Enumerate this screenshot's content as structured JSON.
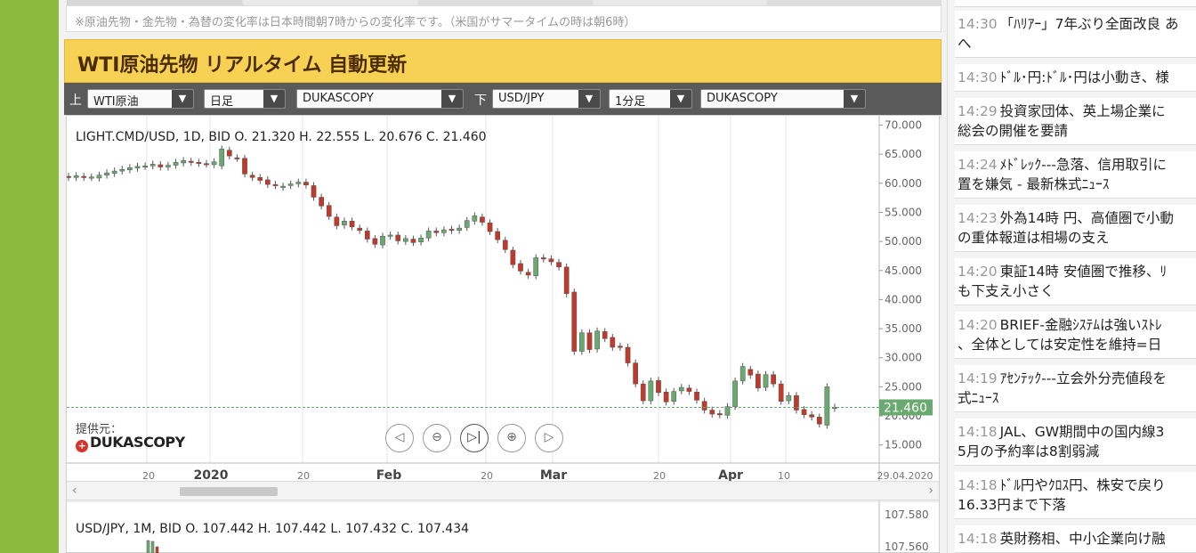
{
  "top_note": "※原油先物・金先物・為替の変化率は日本時間朝7時からの変化率です。（米国がサマータイムの時は朝6時）",
  "section_title": "WTI原油先物 リアルタイム 自動更新",
  "controls": {
    "upper_label": "上",
    "lower_label": "下",
    "upper_symbol": "WTI原油",
    "upper_period": "日足",
    "upper_source": "DUKASCOPY",
    "lower_symbol": "USD/JPY",
    "lower_period": "1分足",
    "lower_source": "DUKASCOPY",
    "dropdown_arrow": "▼"
  },
  "chart_upper": {
    "ohlc_text": "LIGHT.CMD/USD, 1D, BID   O. 21.320 H. 22.555 L. 20.676 C. 21.460",
    "price_ticks": [
      "70.000",
      "65.000",
      "60.000",
      "55.000",
      "50.000",
      "45.000",
      "40.000",
      "35.000",
      "30.000",
      "25.000",
      "20.000",
      "15.000"
    ],
    "current_price": "21.460",
    "x_ticks": [
      "20",
      "2020",
      "20",
      "Feb",
      "20",
      "Mar",
      "20",
      "Apr",
      "10",
      "29.04.2020"
    ],
    "provider_label": "提供元：",
    "provider_logo": "DUKASCOPY"
  },
  "chart_lower": {
    "ohlc_text": "USD/JPY, 1M, BID   O. 107.442 H. 107.442 L. 107.432 C. 107.434",
    "price_ticks": [
      "107.580",
      "107.560"
    ]
  },
  "nav_buttons": [
    {
      "name": "scroll-left-button",
      "glyph": "◁"
    },
    {
      "name": "zoom-out-button",
      "glyph": "⊖"
    },
    {
      "name": "reset-button",
      "glyph": "▷|"
    },
    {
      "name": "zoom-in-button",
      "glyph": "⊕"
    },
    {
      "name": "scroll-right-button",
      "glyph": "▷"
    }
  ],
  "scroll_arrows": {
    "left": "‹",
    "right": "›"
  },
  "colors": {
    "up": "#6aa96f",
    "down": "#c0392b",
    "title_bg": "#f7d154",
    "price_marker": "#6aa96f"
  },
  "news": [
    {
      "time": "14:30",
      "text": "「ﾊﾘｱｰ」7年ぶり全面改良 あ",
      "line2": "へ"
    },
    {
      "time": "14:30",
      "text": "ﾄﾞﾙ･円:ﾄﾞﾙ･円は小動き、様",
      "line2": ""
    },
    {
      "time": "14:29",
      "text": "投資家団体、英上場企業に",
      "line2": "総会の開催を要請"
    },
    {
      "time": "14:24",
      "text": "ﾒﾄﾞﾚｯｸ---急落、信用取引に",
      "line2": "置を嫌気 - 最新株式ﾆｭｰｽ"
    },
    {
      "time": "14:23",
      "text": "外為14時 円、高値圏で小動",
      "line2": "の重体報道は相場の支え"
    },
    {
      "time": "14:20",
      "text": "東証14時 安値圏で推移、ﾘ",
      "line2": "も下支え小さく"
    },
    {
      "time": "14:20",
      "text": "BRIEF-金融ｼｽﾃﾑは強いｽﾄﾚ",
      "line2": "、全体としては安定性を維持=日"
    },
    {
      "time": "14:19",
      "text": "ｱｾﾝﾃｯｸ---立会外分売値段を",
      "line2": "式ﾆｭｰｽ"
    },
    {
      "time": "14:18",
      "text": "JAL、GW期間中の国内線3",
      "line2": "5月の予約率は8割弱減"
    },
    {
      "time": "14:18",
      "text": "ﾄﾞﾙ円やｸﾛｽ円、株安で戻り",
      "line2": "16.33円まで下落"
    },
    {
      "time": "14:18",
      "text": "英財務相、中小企業向け融",
      "line2": ""
    }
  ],
  "chart_data": {
    "type": "candlestick",
    "title": "LIGHT.CMD/USD, 1D, BID",
    "ylim": [
      12.5,
      71
    ],
    "candles": [
      [
        61.2,
        61.0
      ],
      [
        61.0,
        61.3
      ],
      [
        61.2,
        61.0
      ],
      [
        61.0,
        61.1
      ],
      [
        60.9,
        61.4
      ],
      [
        61.4,
        61.8
      ],
      [
        61.7,
        62.1
      ],
      [
        62.1,
        62.4
      ],
      [
        62.3,
        62.7
      ],
      [
        62.6,
        62.9
      ],
      [
        62.9,
        63.0
      ],
      [
        63.0,
        63.3
      ],
      [
        63.2,
        62.8
      ],
      [
        62.8,
        63.1
      ],
      [
        63.1,
        63.6
      ],
      [
        63.5,
        63.9
      ],
      [
        63.8,
        63.6
      ],
      [
        63.6,
        63.4
      ],
      [
        63.4,
        63.3
      ],
      [
        63.2,
        63.7
      ],
      [
        63.0,
        65.9
      ],
      [
        65.7,
        64.7
      ],
      [
        64.4,
        64.3
      ],
      [
        64.3,
        61.6
      ],
      [
        61.4,
        61.0
      ],
      [
        61.0,
        60.5
      ],
      [
        60.6,
        59.8
      ],
      [
        59.8,
        59.6
      ],
      [
        59.3,
        59.5
      ],
      [
        59.6,
        59.9
      ],
      [
        59.9,
        60.2
      ],
      [
        60.2,
        59.7
      ],
      [
        59.6,
        57.6
      ],
      [
        57.6,
        56.1
      ],
      [
        56.2,
        54.3
      ],
      [
        54.2,
        52.7
      ],
      [
        52.8,
        53.5
      ],
      [
        53.5,
        52.5
      ],
      [
        52.3,
        51.9
      ],
      [
        51.8,
        50.4
      ],
      [
        50.5,
        49.5
      ],
      [
        49.4,
        50.9
      ],
      [
        50.9,
        51.1
      ],
      [
        51.1,
        50.1
      ],
      [
        50.0,
        50.5
      ],
      [
        50.4,
        49.8
      ],
      [
        49.9,
        50.6
      ],
      [
        50.6,
        51.8
      ],
      [
        51.8,
        51.5
      ],
      [
        51.5,
        52.0
      ],
      [
        52.1,
        51.9
      ],
      [
        51.9,
        52.3
      ],
      [
        52.4,
        53.6
      ],
      [
        53.5,
        54.4
      ],
      [
        54.2,
        53.3
      ],
      [
        53.2,
        51.7
      ],
      [
        51.7,
        50.3
      ],
      [
        50.2,
        48.6
      ],
      [
        48.5,
        46.0
      ],
      [
        46.2,
        44.9
      ],
      [
        44.7,
        44.2
      ],
      [
        44.1,
        47.2
      ],
      [
        47.2,
        47.0
      ],
      [
        47.0,
        46.5
      ],
      [
        46.4,
        45.6
      ],
      [
        45.6,
        41.0
      ],
      [
        41.3,
        31.1
      ],
      [
        31.1,
        34.3
      ],
      [
        34.3,
        31.4
      ],
      [
        31.5,
        34.6
      ],
      [
        34.5,
        33.3
      ],
      [
        33.5,
        31.8
      ],
      [
        32.0,
        31.8
      ],
      [
        31.8,
        29.1
      ],
      [
        29.1,
        25.5
      ],
      [
        25.5,
        22.6
      ],
      [
        22.6,
        26.0
      ],
      [
        26.1,
        24.0
      ],
      [
        24.1,
        22.4
      ],
      [
        22.5,
        24.2
      ],
      [
        24.3,
        24.9
      ],
      [
        24.8,
        24.2
      ],
      [
        24.1,
        22.7
      ],
      [
        22.5,
        21.0
      ],
      [
        21.0,
        20.3
      ],
      [
        20.4,
        20.2
      ],
      [
        20.1,
        21.6
      ],
      [
        21.6,
        26.0
      ],
      [
        26.0,
        28.5
      ],
      [
        28.0,
        27.0
      ],
      [
        27.2,
        24.8
      ],
      [
        24.9,
        27.1
      ],
      [
        27.1,
        25.5
      ],
      [
        25.5,
        22.5
      ],
      [
        22.6,
        23.5
      ],
      [
        23.5,
        21.0
      ],
      [
        21.1,
        20.2
      ],
      [
        20.2,
        19.8
      ],
      [
        19.8,
        18.6
      ],
      [
        18.4,
        25.0
      ],
      [
        21.3,
        21.5
      ]
    ]
  }
}
